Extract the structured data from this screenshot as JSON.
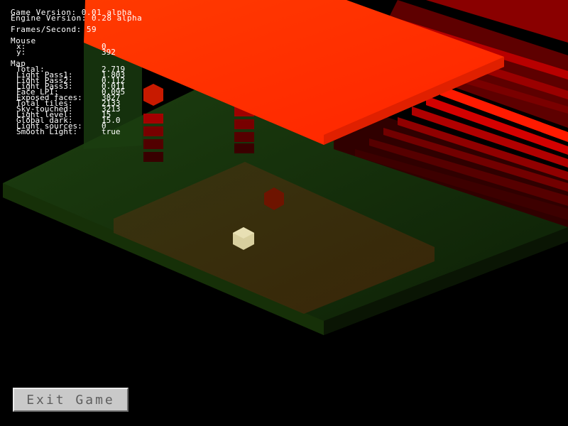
{
  "hud": {
    "game_version": "Game Version: 0.01 alpha",
    "engine_version": "Engine Version: 0.28 alpha",
    "fps": "Frames/Second: 59",
    "mouse_header": "Mouse",
    "mouse_x_label": "x:",
    "mouse_x_value": "0",
    "mouse_y_label": "y:",
    "mouse_y_value": "392",
    "map_header": "Map",
    "map_stats": [
      {
        "label": "Total:",
        "value": "2.719"
      },
      {
        "label": "Light Pass1:",
        "value": "1.803"
      },
      {
        "label": "Light Pass2:",
        "value": "0.112"
      },
      {
        "label": "Light Pass3:",
        "value": "0.011"
      },
      {
        "label": "Face LPI:",
        "value": "0.095"
      },
      {
        "label": "Exposed faces:",
        "value": "3827"
      },
      {
        "label": "Total tiles:",
        "value": "2133"
      },
      {
        "label": "Sky-touched:",
        "value": "3213"
      },
      {
        "label": "Light level:",
        "value": "15"
      },
      {
        "label": "Global dark:",
        "value": "15.0"
      },
      {
        "label": "Light sources:",
        "value": "0"
      },
      {
        "label": "Smooth Light:",
        "value": "true"
      }
    ]
  },
  "buttons": {
    "exit_label": "Exit Game"
  },
  "colors": {
    "hud_text": "#ffffff",
    "red_bright": "#ff2a00",
    "red_dark": "#5a0000",
    "floor_green": "#1f3a0e",
    "floor_brown": "#3a2a0a",
    "cube_cream": "#d8cf9e"
  }
}
